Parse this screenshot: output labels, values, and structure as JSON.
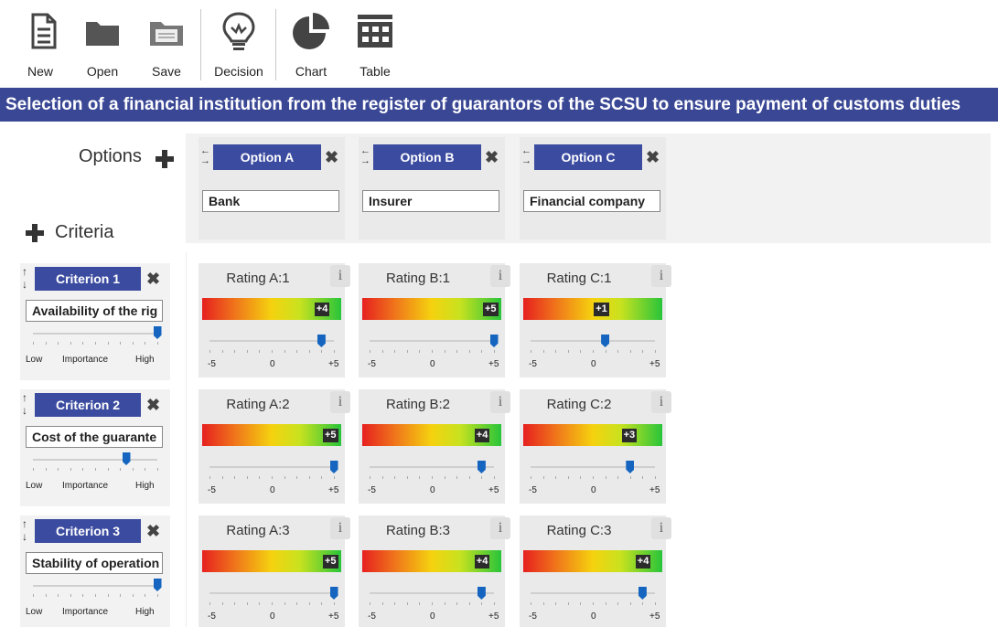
{
  "toolbar": {
    "new_label": "New",
    "open_label": "Open",
    "save_label": "Save",
    "decision_label": "Decision",
    "chart_label": "Chart",
    "table_label": "Table"
  },
  "title": "Selection of a financial institution from the register of guarantors of the SCSU to ensure payment of customs duties",
  "options_label": "Options",
  "criteria_label": "Criteria",
  "options": [
    {
      "header": "Option A",
      "value": "Bank"
    },
    {
      "header": "Option B",
      "value": "Insurer"
    },
    {
      "header": "Option C",
      "value": "Financial company"
    }
  ],
  "criteria": [
    {
      "header": "Criterion 1",
      "value": "Availability of the rig",
      "importance": 1.0
    },
    {
      "header": "Criterion 2",
      "value": "Cost of the guarante",
      "importance": 0.75
    },
    {
      "header": "Criterion 3",
      "value": "Stability of operation",
      "importance": 1.0
    }
  ],
  "importance_labels": {
    "low": "Low",
    "mid": "Importance",
    "high": "High"
  },
  "rating_scale": {
    "min": "-5",
    "mid": "0",
    "max": "+5"
  },
  "info_glyph": "i",
  "ratings": [
    [
      {
        "title": "Rating A:1",
        "label": "+4",
        "value": 4
      },
      {
        "title": "Rating B:1",
        "label": "+5",
        "value": 5
      },
      {
        "title": "Rating C:1",
        "label": "+1",
        "value": 1
      }
    ],
    [
      {
        "title": "Rating A:2",
        "label": "+5",
        "value": 5
      },
      {
        "title": "Rating B:2",
        "label": "+4",
        "value": 4
      },
      {
        "title": "Rating C:2",
        "label": "+3",
        "value": 3
      }
    ],
    [
      {
        "title": "Rating A:3",
        "label": "+5",
        "value": 5
      },
      {
        "title": "Rating B:3",
        "label": "+4",
        "value": 4
      },
      {
        "title": "Rating C:3",
        "label": "+4",
        "value": 4
      }
    ]
  ],
  "colors": {
    "title_bar": "#3a4795",
    "header_blue": "#3b4ba0",
    "thumb": "#1565c0"
  }
}
